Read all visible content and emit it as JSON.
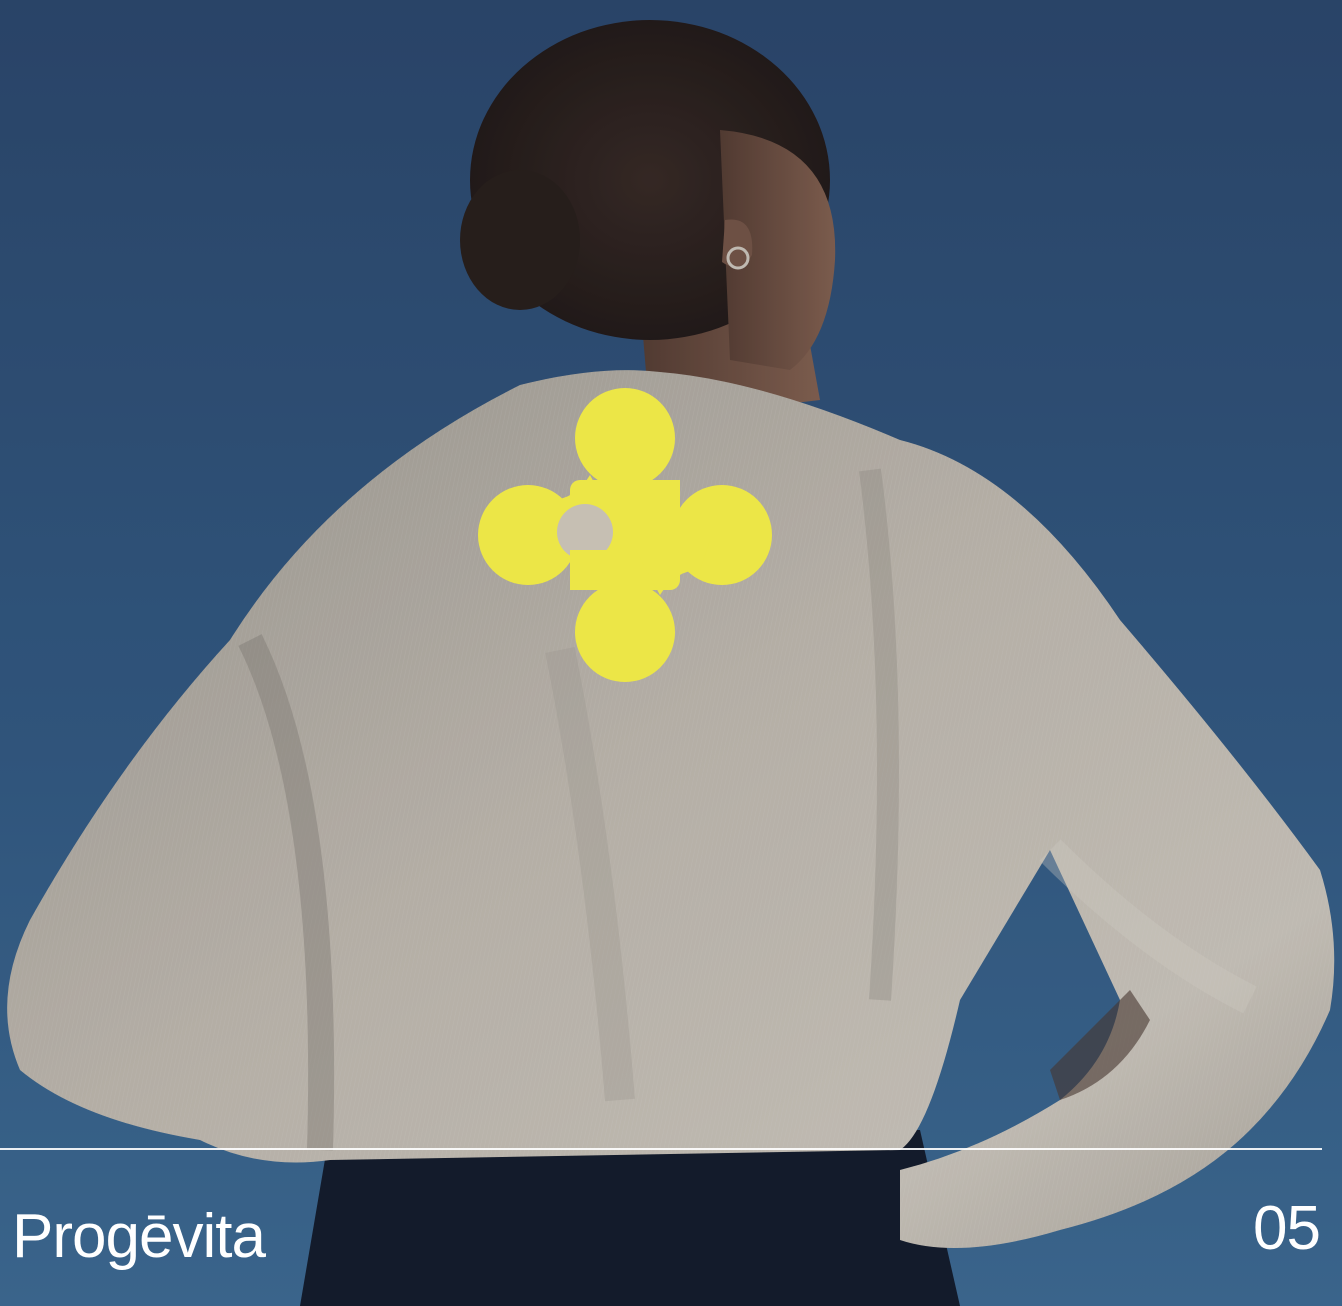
{
  "brand": {
    "name": "Progēvita",
    "accent_color": "#ece647",
    "icon": "progevita-logo-icon"
  },
  "slide": {
    "page_number": "05"
  },
  "colors": {
    "sky_top": "#2e4d74",
    "sky_bottom": "#3f6e98",
    "shirt": "#cfc7bb",
    "text": "#ffffff"
  }
}
